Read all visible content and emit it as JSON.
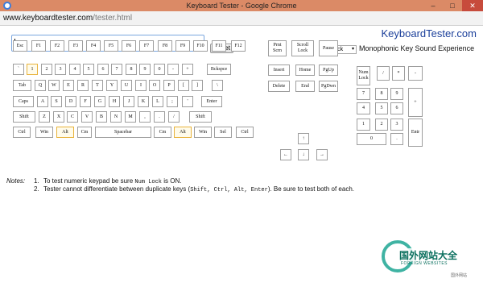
{
  "window": {
    "title": "Keyboard Tester - Google Chrome",
    "minimize": "–",
    "maximize": "□",
    "close": "✕"
  },
  "address": {
    "domain": "www.keyboardtester.com",
    "path": "/tester.html"
  },
  "brand": "KeyboardTester.com",
  "reset_label": "Reset",
  "sound": {
    "selected": "Click",
    "label": "Monophonic Key Sound Experience"
  },
  "keys": {
    "fn": [
      "Esc",
      "F1",
      "F2",
      "F3",
      "F4",
      "F5",
      "F6",
      "F7",
      "F8",
      "F9",
      "F10",
      "F11",
      "F12"
    ],
    "sys": [
      "Prnt Scrn",
      "Scroll Lock",
      "Pause"
    ],
    "num_row": [
      "`",
      "1",
      "2",
      "3",
      "4",
      "5",
      "6",
      "7",
      "8",
      "9",
      "0",
      "-",
      "+",
      "Bckspce"
    ],
    "tab_row": [
      "Tab",
      "Q",
      "W",
      "E",
      "R",
      "T",
      "Y",
      "U",
      "I",
      "O",
      "P",
      "[",
      "]",
      "\\"
    ],
    "caps_row": [
      "Caps",
      "A",
      "S",
      "D",
      "F",
      "G",
      "H",
      "J",
      "K",
      "L",
      ";",
      "'",
      "Enter"
    ],
    "shift_row": [
      "Shift",
      "Z",
      "X",
      "C",
      "V",
      "B",
      "N",
      "M",
      ",",
      ".",
      "/",
      "Shift"
    ],
    "ctrl_row": [
      "Ctrl",
      "Win",
      "Alt",
      "Cm",
      "Spacebar",
      "Cm",
      "Alt",
      "Win",
      "Sel",
      "Ctrl"
    ],
    "nav1": [
      "Insert",
      "Home",
      "PgUp"
    ],
    "nav2": [
      "Delete",
      "End",
      "PgDwn"
    ],
    "arrows": [
      "↑",
      "←",
      "↓",
      "→"
    ],
    "numpad": [
      "Num Lock",
      "/",
      "*",
      "-",
      "7",
      "8",
      "9",
      "+",
      "4",
      "5",
      "6",
      "1",
      "2",
      "3",
      "Entr",
      "0",
      "."
    ]
  },
  "notes": {
    "label": "Notes:",
    "n1": "1.",
    "n1a": "To test numeric keypad be sure",
    "n1b": "Num Lock",
    "n1c": "is ON.",
    "n2": "2.",
    "n2a": "Tester cannot differentiate between duplicate keys (",
    "n2b": "Shift, Ctrl, Alt, Enter",
    "n2c": "). Be sure to test both of each."
  },
  "watermark": {
    "cn": "国外网站大全",
    "en": "FOREIGN WEBSITES",
    "small": "国外网站"
  }
}
